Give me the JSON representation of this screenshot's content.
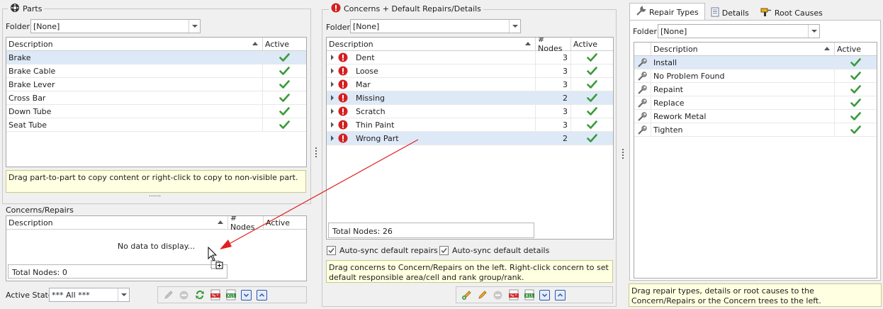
{
  "parts": {
    "title": "Parts",
    "folder_label": "Folder",
    "folder_value": "[None]",
    "columns": [
      "Description",
      "Active"
    ],
    "rows": [
      {
        "description": "Brake",
        "active": true
      },
      {
        "description": "Brake Cable",
        "active": true
      },
      {
        "description": "Brake Lever",
        "active": true
      },
      {
        "description": "Cross Bar",
        "active": true
      },
      {
        "description": "Down Tube",
        "active": true
      },
      {
        "description": "Seat Tube",
        "active": true
      }
    ],
    "hint": "Drag part-to-part to copy content or right-click to copy to non-visible part.",
    "splitter": "......"
  },
  "concerns_repairs": {
    "title": "Concerns/Repairs",
    "columns": [
      "Description",
      "# Nodes",
      "Active"
    ],
    "empty_text": "No data to display...",
    "total": "Total Nodes: 0",
    "active_state_label": "Active State",
    "active_state_value": "*** All ***"
  },
  "concerns": {
    "title": "Concerns + Default Repairs/Details",
    "folder_label": "Folder",
    "folder_value": "[None]",
    "columns": [
      "Description",
      "# Nodes",
      "Active"
    ],
    "rows": [
      {
        "description": "Dent",
        "nodes": "3",
        "active": true
      },
      {
        "description": "Loose",
        "nodes": "3",
        "active": true
      },
      {
        "description": "Mar",
        "nodes": "3",
        "active": true
      },
      {
        "description": "Missing",
        "nodes": "2",
        "active": true
      },
      {
        "description": "Scratch",
        "nodes": "3",
        "active": true
      },
      {
        "description": "Thin Paint",
        "nodes": "3",
        "active": true
      },
      {
        "description": "Wrong Part",
        "nodes": "2",
        "active": true
      }
    ],
    "total": "Total Nodes: 26",
    "autosync_repairs": "Auto-sync default repairs",
    "autosync_details": "Auto-sync default details",
    "hint": "Drag concerns to Concern/Repairs on the left. Right-click concern to set default responsible area/cell and rank group/rank."
  },
  "repairs": {
    "tabs": [
      "Repair Types",
      "Details",
      "Root Causes"
    ],
    "folder_label": "Folder",
    "folder_value": "[None]",
    "columns": [
      "Description",
      "Active"
    ],
    "rows": [
      {
        "description": "Install",
        "active": true
      },
      {
        "description": "No Problem Found",
        "active": true
      },
      {
        "description": "Repaint",
        "active": true
      },
      {
        "description": "Replace",
        "active": true
      },
      {
        "description": "Rework Metal",
        "active": true
      },
      {
        "description": "Tighten",
        "active": true
      }
    ],
    "hint": "Drag repair types, details or root causes to the Concern/Repairs or the Concern trees to the left."
  },
  "colors": {
    "check": "#3a9a3a",
    "alert": "#d42020",
    "selected_row": "#dde9f7",
    "hint_bg": "#ffffe1",
    "drag_arrow": "#e02020"
  }
}
